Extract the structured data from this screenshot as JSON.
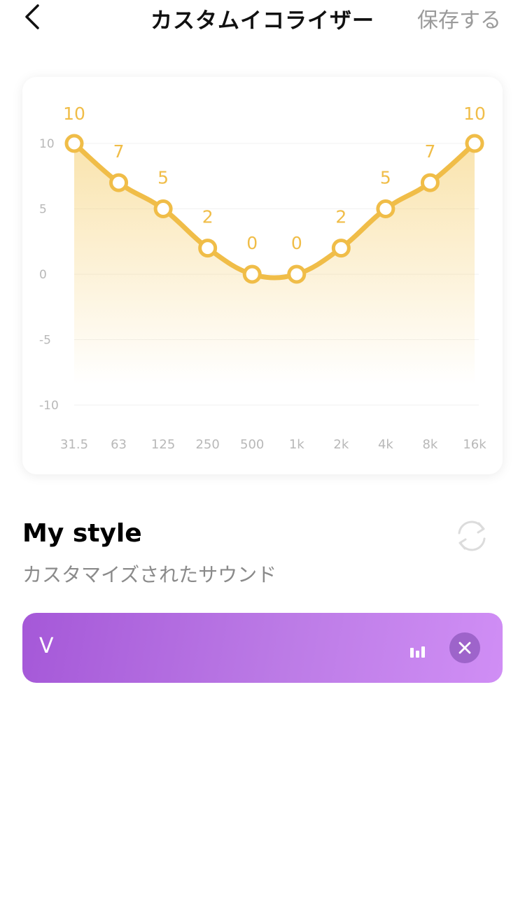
{
  "header": {
    "title": "カスタムイコライザー",
    "save_label": "保存する",
    "back_icon": "chevron-left-icon"
  },
  "chart_data": {
    "type": "area",
    "x": [
      "31.5",
      "63",
      "125",
      "250",
      "500",
      "1k",
      "2k",
      "4k",
      "8k",
      "16k"
    ],
    "values": [
      10,
      7,
      5,
      2,
      0,
      0,
      2,
      5,
      7,
      10
    ],
    "data_labels": [
      "10",
      "7",
      "5",
      "2",
      "0",
      "0",
      "2",
      "5",
      "7",
      "10"
    ],
    "yticks": [
      "10",
      "5",
      "0",
      "-5",
      "-10"
    ],
    "ylim": [
      -10,
      10
    ],
    "grid": true,
    "line_color": "#f0bd48",
    "label_color": "#f0bd48"
  },
  "style": {
    "name": "My style",
    "subtitle": "カスタマイズされたサウンド",
    "reset_icon": "refresh-icon"
  },
  "preset_bar": {
    "letter": "V",
    "bars_icon": "equalizer-bars-icon",
    "close_icon": "close-icon"
  },
  "colors": {
    "accent": "#f0bd48",
    "preset_gradient_start": "#a558d8",
    "preset_gradient_end": "#d08ef5"
  }
}
